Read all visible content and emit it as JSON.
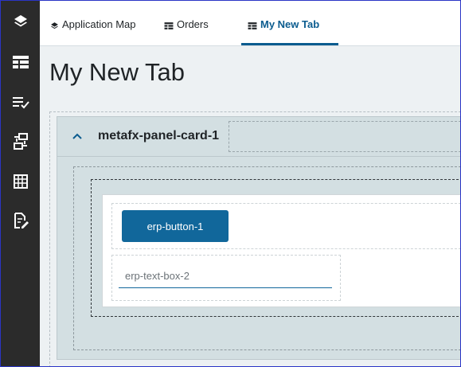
{
  "rail": {
    "icons": [
      {
        "name": "layers-icon"
      },
      {
        "name": "table-layout-icon"
      },
      {
        "name": "list-check-icon"
      },
      {
        "name": "transfer-icon"
      },
      {
        "name": "calendar-grid-icon"
      },
      {
        "name": "document-edit-icon"
      }
    ],
    "color": "#2b2b2b"
  },
  "tabs": [
    {
      "label": "Application Map",
      "icon": "layers-icon",
      "active": false
    },
    {
      "label": "Orders",
      "icon": "table-layout-icon",
      "active": false
    },
    {
      "label": "My New Tab",
      "icon": "table-layout-icon",
      "active": true
    }
  ],
  "page": {
    "title": "My New Tab"
  },
  "panel": {
    "title": "metafx-panel-card-1",
    "expanded": true
  },
  "button": {
    "label": "erp-button-1"
  },
  "textbox": {
    "placeholder": "erp-text-box-2",
    "value": ""
  },
  "colors": {
    "accent": "#0b5c8f",
    "button": "#11679b",
    "panel": "#d3dfe2",
    "frame_border": "#2b35c6"
  }
}
